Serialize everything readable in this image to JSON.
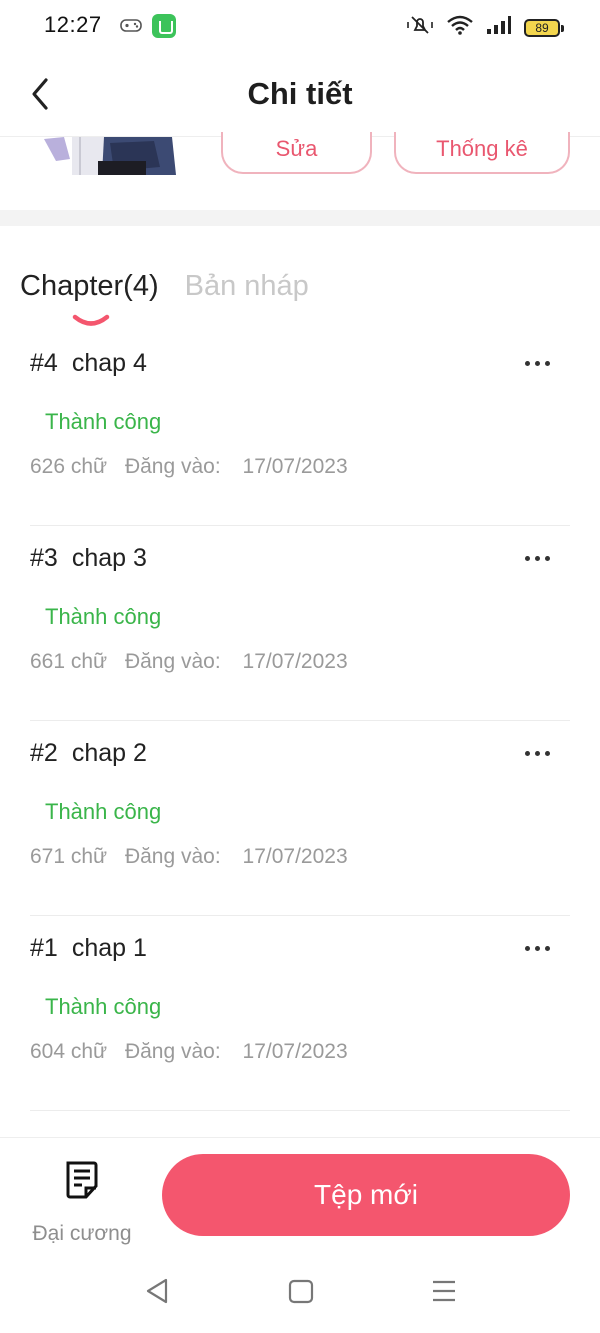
{
  "status_bar": {
    "time": "12:27",
    "battery": "89",
    "icons": [
      "game-controller-icon",
      "app-notification-icon",
      "mute-icon",
      "wifi-icon",
      "signal-icon",
      "battery-icon"
    ]
  },
  "header": {
    "title": "Chi tiết",
    "back_icon": "chevron-left-icon"
  },
  "story_actions": {
    "edit_label": "Sửa",
    "stats_label": "Thống kê"
  },
  "tabs": [
    {
      "label": "Chapter(4)",
      "active": true
    },
    {
      "label": "Bản nháp",
      "active": false
    }
  ],
  "chapters": [
    {
      "num": "#4",
      "name": "chap 4",
      "status": "Thành công",
      "words": "626 chữ",
      "posted_label": "Đăng vào:",
      "date": "17/07/2023"
    },
    {
      "num": "#3",
      "name": "chap 3",
      "status": "Thành công",
      "words": "661 chữ",
      "posted_label": "Đăng vào:",
      "date": "17/07/2023"
    },
    {
      "num": "#2",
      "name": "chap 2",
      "status": "Thành công",
      "words": "671 chữ",
      "posted_label": "Đăng vào:",
      "date": "17/07/2023"
    },
    {
      "num": "#1",
      "name": "chap 1",
      "status": "Thành công",
      "words": "604 chữ",
      "posted_label": "Đăng vào:",
      "date": "17/07/2023"
    }
  ],
  "bottom": {
    "outline_label": "Đại cương",
    "new_file_label": "Tệp mới"
  },
  "colors": {
    "accent": "#f4566e",
    "success": "#3ab54a",
    "muted": "#9a9a9a"
  }
}
